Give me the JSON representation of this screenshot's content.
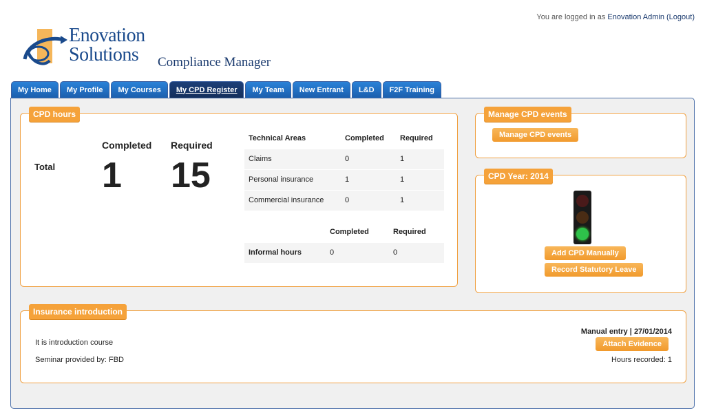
{
  "header": {
    "login_prefix": "You are logged in as",
    "user": "Enovation Admin",
    "logout": "(Logout)",
    "logo_line1": "Enovation",
    "logo_line2": "Solutions",
    "app_title": "Compliance Manager"
  },
  "tabs": [
    {
      "label": "My Home"
    },
    {
      "label": "My Profile"
    },
    {
      "label": "My Courses"
    },
    {
      "label": "My CPD Register",
      "active": true
    },
    {
      "label": "My Team"
    },
    {
      "label": "New Entrant"
    },
    {
      "label": "L&D"
    },
    {
      "label": "F2F Training"
    }
  ],
  "cpd_hours": {
    "title": "CPD hours",
    "completed_label": "Completed",
    "required_label": "Required",
    "total_label": "Total",
    "completed_value": "1",
    "required_value": "15",
    "areas_headers": [
      "Technical Areas",
      "Completed",
      "Required"
    ],
    "areas_rows": [
      [
        "Claims",
        "0",
        "1"
      ],
      [
        "Personal insurance",
        "1",
        "1"
      ],
      [
        "Commercial insurance",
        "0",
        "1"
      ]
    ],
    "informal_headers": [
      "",
      "Completed",
      "Required"
    ],
    "informal_row": [
      "Informal hours",
      "0",
      "0"
    ]
  },
  "manage_events": {
    "title": "Manage CPD events",
    "button": "Manage CPD events"
  },
  "cpd_year": {
    "title": "CPD Year: 2014",
    "add_button": "Add CPD Manually",
    "leave_button": "Record Statutory Leave",
    "traffic_light": "green"
  },
  "course": {
    "title": "Insurance introduction",
    "description": "It is introduction course",
    "provider": "Seminar provided by: FBD",
    "entry": "Manual entry | 27/01/2014",
    "attach_button": "Attach Evidence",
    "hours": "Hours recorded: 1"
  },
  "colors": {
    "tab_blue": "#1f6fbf",
    "tab_active": "#142f5c",
    "orange": "#f5a23a"
  }
}
